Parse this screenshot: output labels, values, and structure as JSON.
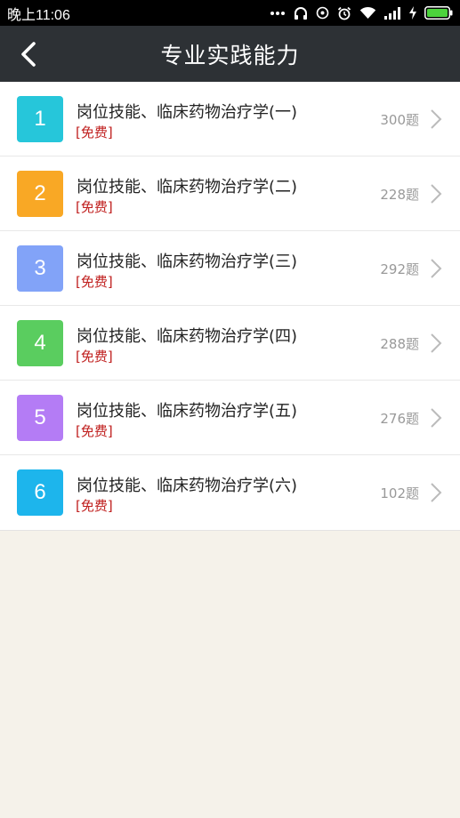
{
  "status_bar": {
    "time": "晚上11:06"
  },
  "nav": {
    "title": "专业实践能力",
    "back_icon": "chevron-left-icon"
  },
  "items": [
    {
      "number": "1",
      "title": "岗位技能、临床药物治疗学(一)",
      "tag": "[免费]",
      "count": "300题",
      "color": "#26c6da"
    },
    {
      "number": "2",
      "title": "岗位技能、临床药物治疗学(二)",
      "tag": "[免费]",
      "count": "228题",
      "color": "#f9a825"
    },
    {
      "number": "3",
      "title": "岗位技能、临床药物治疗学(三)",
      "tag": "[免费]",
      "count": "292题",
      "color": "#82a3f8"
    },
    {
      "number": "4",
      "title": "岗位技能、临床药物治疗学(四)",
      "tag": "[免费]",
      "count": "288题",
      "color": "#5acd5f"
    },
    {
      "number": "5",
      "title": "岗位技能、临床药物治疗学(五)",
      "tag": "[免费]",
      "count": "276题",
      "color": "#b47cf5"
    },
    {
      "number": "6",
      "title": "岗位技能、临床药物治疗学(六)",
      "tag": "[免费]",
      "count": "102题",
      "color": "#1db5ec"
    }
  ],
  "colors": {
    "nav_bg": "#2d3135",
    "tag": "#c0201f",
    "page_bg": "#f5f2ea"
  }
}
